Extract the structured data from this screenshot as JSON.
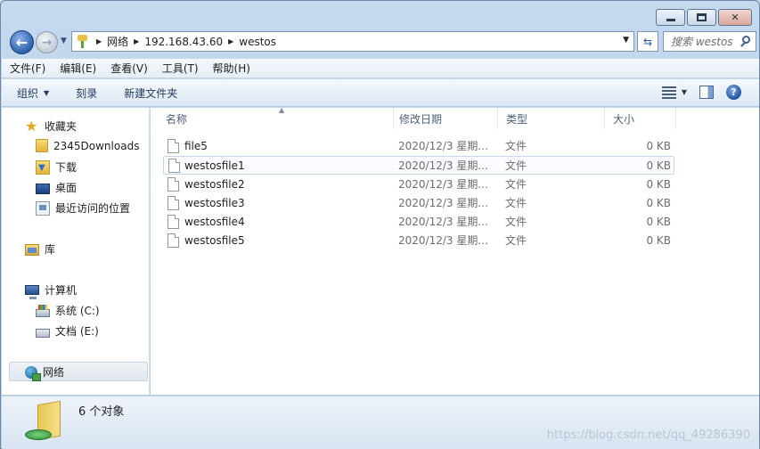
{
  "window": {
    "caption_buttons": [
      "minimize",
      "maximize",
      "close"
    ]
  },
  "address_bar": {
    "breadcrumbs": [
      "网络",
      "192.168.43.60",
      "westos"
    ]
  },
  "search": {
    "placeholder": "搜索 westos"
  },
  "menu": {
    "items": [
      "文件(F)",
      "编辑(E)",
      "查看(V)",
      "工具(T)",
      "帮助(H)"
    ]
  },
  "toolbar": {
    "organize_label": "组织",
    "burn_label": "刻录",
    "new_folder_label": "新建文件夹",
    "help_label": "?"
  },
  "nav_pane": {
    "favorites": "收藏夹",
    "favorite_items": [
      "2345Downloads",
      "下载",
      "桌面",
      "最近访问的位置"
    ],
    "libraries": "库",
    "computer": "计算机",
    "drives": [
      "系统 (C:)",
      "文档 (E:)"
    ],
    "network": "网络"
  },
  "file_list": {
    "columns": [
      "名称",
      "修改日期",
      "类型",
      "大小"
    ],
    "rows": [
      {
        "name": "file5",
        "date": "2020/12/3 星期...",
        "type": "文件",
        "size": "0 KB"
      },
      {
        "name": "westosfile1",
        "date": "2020/12/3 星期...",
        "type": "文件",
        "size": "0 KB"
      },
      {
        "name": "westosfile2",
        "date": "2020/12/3 星期...",
        "type": "文件",
        "size": "0 KB"
      },
      {
        "name": "westosfile3",
        "date": "2020/12/3 星期...",
        "type": "文件",
        "size": "0 KB"
      },
      {
        "name": "westosfile4",
        "date": "2020/12/3 星期...",
        "type": "文件",
        "size": "0 KB"
      },
      {
        "name": "westosfile5",
        "date": "2020/12/3 星期...",
        "type": "文件",
        "size": "0 KB"
      }
    ]
  },
  "details": {
    "count": "6 个对象"
  },
  "watermark": "https://blog.csdn.net/qq_49286390",
  "colors": {
    "frame": "#b9d0e8",
    "accent": "#2d5fae"
  }
}
